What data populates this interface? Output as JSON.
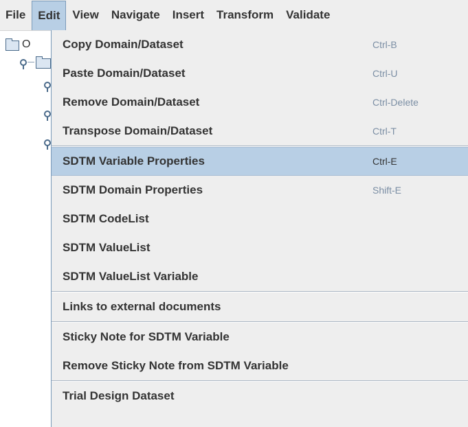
{
  "menubar": {
    "items": [
      {
        "label": "File"
      },
      {
        "label": "Edit"
      },
      {
        "label": "View"
      },
      {
        "label": "Navigate"
      },
      {
        "label": "Insert"
      },
      {
        "label": "Transform"
      },
      {
        "label": "Validate"
      }
    ],
    "active": "Edit"
  },
  "tree": {
    "root_fragment": "O"
  },
  "edit_menu": {
    "items": [
      {
        "label": "Copy Domain/Dataset",
        "shortcut": "Ctrl-B"
      },
      {
        "label": "Paste Domain/Dataset",
        "shortcut": "Ctrl-U"
      },
      {
        "label": "Remove Domain/Dataset",
        "shortcut": "Ctrl-Delete"
      },
      {
        "label": "Transpose Domain/Dataset",
        "shortcut": "Ctrl-T"
      },
      {
        "label": "SDTM Variable Properties",
        "shortcut": "Ctrl-E"
      },
      {
        "label": "SDTM Domain Properties",
        "shortcut": "Shift-E"
      },
      {
        "label": "SDTM CodeList",
        "shortcut": ""
      },
      {
        "label": "SDTM ValueList",
        "shortcut": ""
      },
      {
        "label": "SDTM ValueList Variable",
        "shortcut": ""
      },
      {
        "label": "Links to external documents",
        "shortcut": ""
      },
      {
        "label": "Sticky Note for SDTM Variable",
        "shortcut": ""
      },
      {
        "label": "Remove Sticky Note from SDTM Variable",
        "shortcut": ""
      },
      {
        "label": "Trial Design Dataset",
        "shortcut": ""
      }
    ],
    "highlighted": "SDTM Variable Properties"
  },
  "colors": {
    "menu_background": "#eeeeee",
    "highlight": "#b8cfe5",
    "shortcut_text": "#7b8ea4",
    "text": "#333333"
  }
}
